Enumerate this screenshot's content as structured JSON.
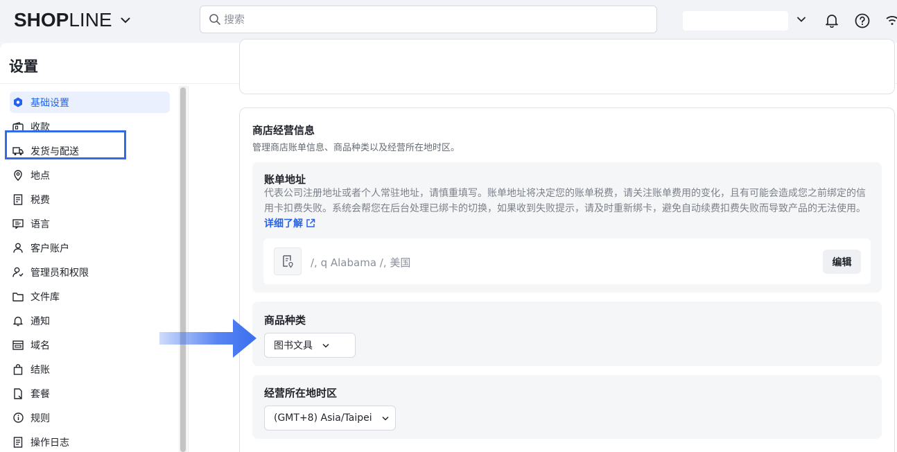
{
  "header": {
    "logo_bold": "SHOP",
    "logo_thin": "LINE",
    "search_placeholder": "搜索",
    "icons": [
      "search-icon",
      "chevron-down-icon",
      "bell-icon",
      "help-icon",
      "wifi-icon"
    ]
  },
  "page": {
    "title": "设置"
  },
  "sidebar": {
    "items": [
      {
        "label": "基础设置",
        "icon": "hexagon-settings-icon",
        "active": true
      },
      {
        "label": "收款",
        "icon": "wallet-icon"
      },
      {
        "label": "发货与配送",
        "icon": "truck-icon"
      },
      {
        "label": "地点",
        "icon": "location-pin-icon"
      },
      {
        "label": "税费",
        "icon": "tax-document-icon"
      },
      {
        "label": "语言",
        "icon": "language-icon"
      },
      {
        "label": "客户账户",
        "icon": "user-icon"
      },
      {
        "label": "管理员和权限",
        "icon": "admin-user-icon"
      },
      {
        "label": "文件库",
        "icon": "folder-icon"
      },
      {
        "label": "通知",
        "icon": "bell-icon"
      },
      {
        "label": "域名",
        "icon": "domain-icon"
      },
      {
        "label": "结账",
        "icon": "bag-icon"
      },
      {
        "label": "套餐",
        "icon": "plan-icon"
      },
      {
        "label": "规则",
        "icon": "info-icon"
      },
      {
        "label": "操作日志",
        "icon": "log-icon"
      }
    ]
  },
  "store_info": {
    "title": "商店经营信息",
    "subtitle": "管理商店账单信息、商品种类以及经营所在地时区。",
    "billing": {
      "title": "账单地址",
      "description": "代表公司注册地址或者个人常驻地址，请慎重填写。账单地址将决定您的账单税费，请关注账单费用的变化，且有可能会造成您之前绑定的信用卡扣费失败。系统会帮您在后台处理已绑卡的切换，如果收到失败提示，请及时重新绑卡，避免自动续费扣费失败而导致产品的无法使用。",
      "link": "详细了解",
      "address": "/, q Alabama /, 美国",
      "edit": "编辑"
    },
    "category": {
      "title": "商品种类",
      "value": "图书文具"
    },
    "timezone": {
      "title": "经营所在地时区",
      "value": "(GMT+8) Asia/Taipei"
    }
  },
  "colors": {
    "accent": "#2563eb",
    "highlight_box": "#2f6ce5",
    "arrow": "#3b6ff0"
  }
}
